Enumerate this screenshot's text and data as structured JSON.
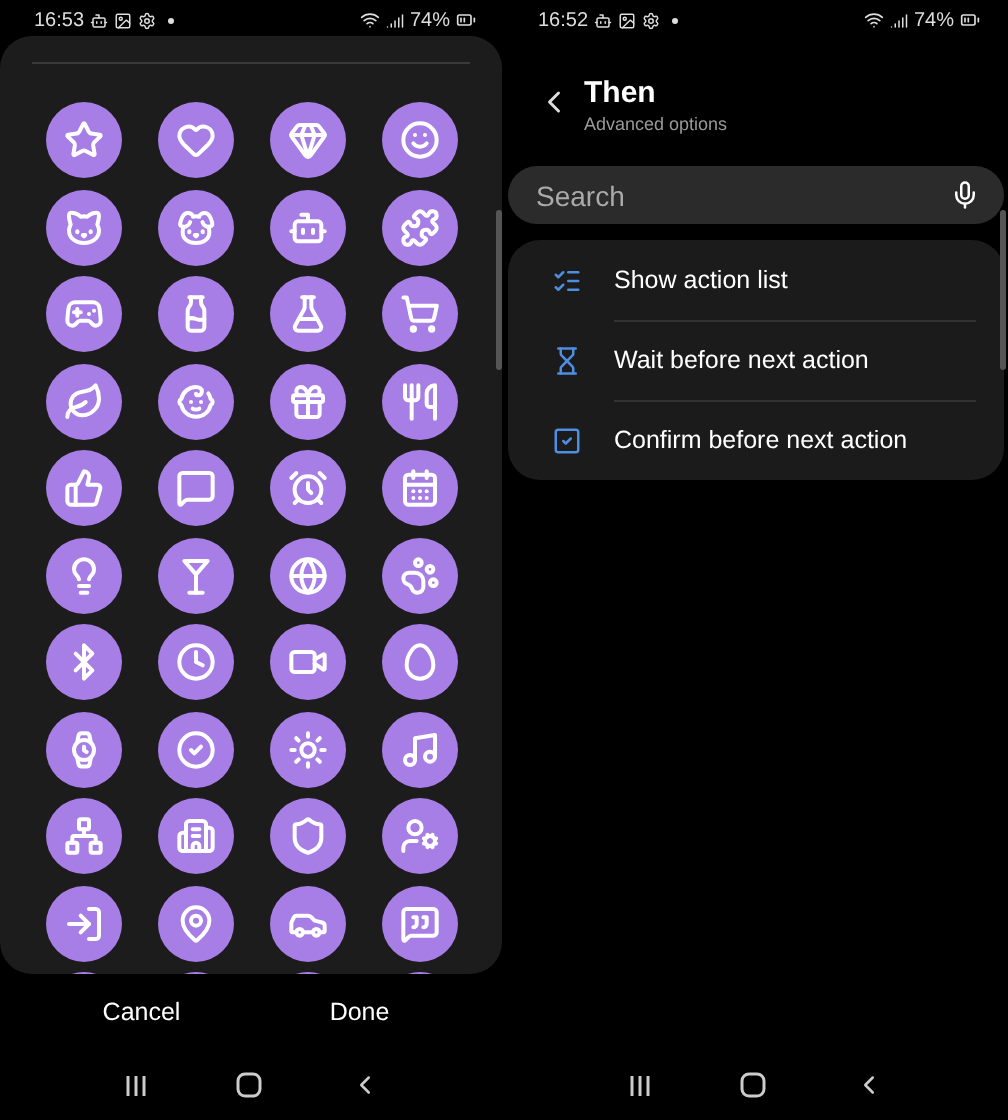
{
  "left": {
    "status_bar": {
      "time": "16:53",
      "battery": "74%"
    },
    "buttons": [
      "Cancel",
      "Done"
    ]
  },
  "right": {
    "status_bar": {
      "time": "16:52",
      "battery": "74%"
    },
    "header": {
      "title": "Then",
      "subtitle": "Advanced options"
    },
    "search": {
      "placeholder": "Search"
    },
    "options": [
      {
        "label": "Show action list"
      },
      {
        "label": "Wait before next action"
      },
      {
        "label": "Confirm before next action"
      }
    ]
  }
}
